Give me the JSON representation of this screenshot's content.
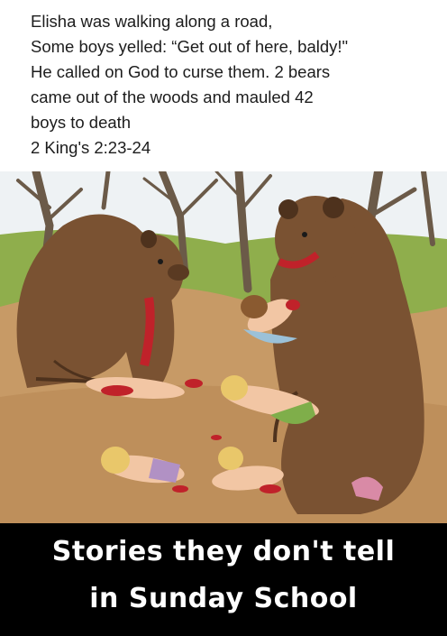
{
  "caption": {
    "lines": [
      "Elisha was walking along a road,",
      "Some boys yelled: “Get out of here, baldy!\"",
      "He called on God  to curse them. 2 bears",
      "came out of the woods and mauled 42",
      "boys to death",
      "2 King's 2:23-24"
    ]
  },
  "illustration": {
    "subject": "two brown bears attacking children on a dirt path among bare trees",
    "colors": {
      "sky": "#eef2f4",
      "grass": "#8fae4c",
      "ground": "#c79a66",
      "bear": "#7a5232",
      "bear_dark": "#4e321d",
      "blood": "#c0222a",
      "skin": "#f2c6a4",
      "hair": "#e9c76a"
    }
  },
  "banner": {
    "line1": "Stories they don't tell",
    "line2": "in Sunday School"
  }
}
